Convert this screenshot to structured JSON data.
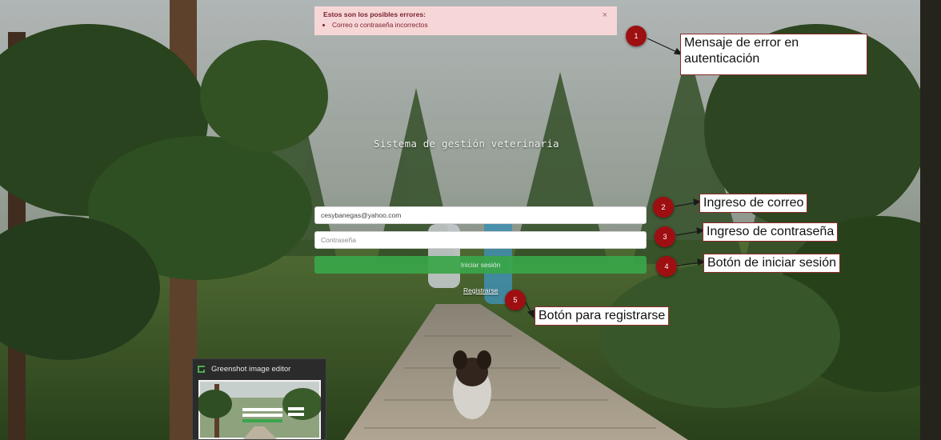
{
  "alert": {
    "title": "Estos son los posibles errores:",
    "items": [
      "Correo o contraseña incorrectos"
    ],
    "close": "×"
  },
  "app": {
    "title": "Sistema de gestión veterinaria"
  },
  "form": {
    "email_value": "cesybanegas@yahoo.com",
    "email_placeholder": "",
    "password_placeholder": "Contraseña",
    "login_label": "Iniciar sesión",
    "register_label": "Registrarse"
  },
  "annotations": [
    {
      "number": "1",
      "text": "Mensaje de error en autenticación"
    },
    {
      "number": "2",
      "text": "Ingreso de correo"
    },
    {
      "number": "3",
      "text": "Ingreso de contraseña"
    },
    {
      "number": "4",
      "text": "Botón de iniciar sesión"
    },
    {
      "number": "5",
      "text": "Botón para registrarse"
    }
  ],
  "greenshot": {
    "label": "Greenshot image editor"
  },
  "colors": {
    "accent": "#3aa64a",
    "marker": "#9e0f12",
    "alert_bg": "#f7d6d8"
  }
}
